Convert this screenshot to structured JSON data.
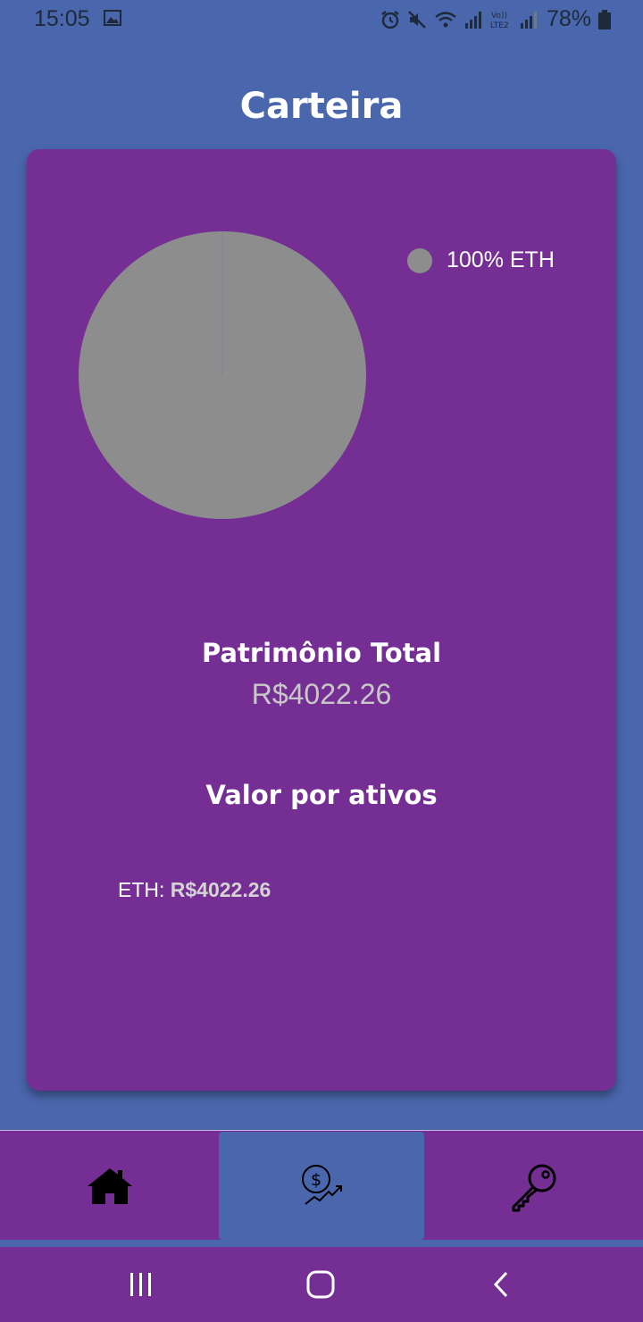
{
  "status_bar": {
    "time": "15:05",
    "battery": "78%",
    "icons": [
      "gallery-icon",
      "alarm-icon",
      "mute-icon",
      "wifi-icon",
      "signal-icon",
      "volte-lte2-icon",
      "signal-icon",
      "battery-icon"
    ]
  },
  "page": {
    "title": "Carteira"
  },
  "card": {
    "legend_label": "100% ETH",
    "total_label": "Patrimônio Total",
    "total_value": "R$4022.26",
    "assets_title": "Valor por ativos",
    "assets": [
      {
        "symbol": "ETH: ",
        "value": "R$4022.26"
      }
    ]
  },
  "chart_data": {
    "type": "pie",
    "slices": [
      {
        "label": "ETH",
        "value": 100,
        "color": "#8d8d8d"
      }
    ]
  },
  "bottom_nav": {
    "items": [
      {
        "icon": "home-icon",
        "active": false
      },
      {
        "icon": "money-growth-icon",
        "active": true
      },
      {
        "icon": "key-icon",
        "active": false
      }
    ]
  },
  "system_nav": {
    "buttons": [
      "recent-apps-icon",
      "home-circle-icon",
      "back-icon"
    ]
  },
  "colors": {
    "background": "#4a67ad",
    "card": "#752f94",
    "slice": "#8d8d8d",
    "muted_text": "#c8c8c8"
  }
}
